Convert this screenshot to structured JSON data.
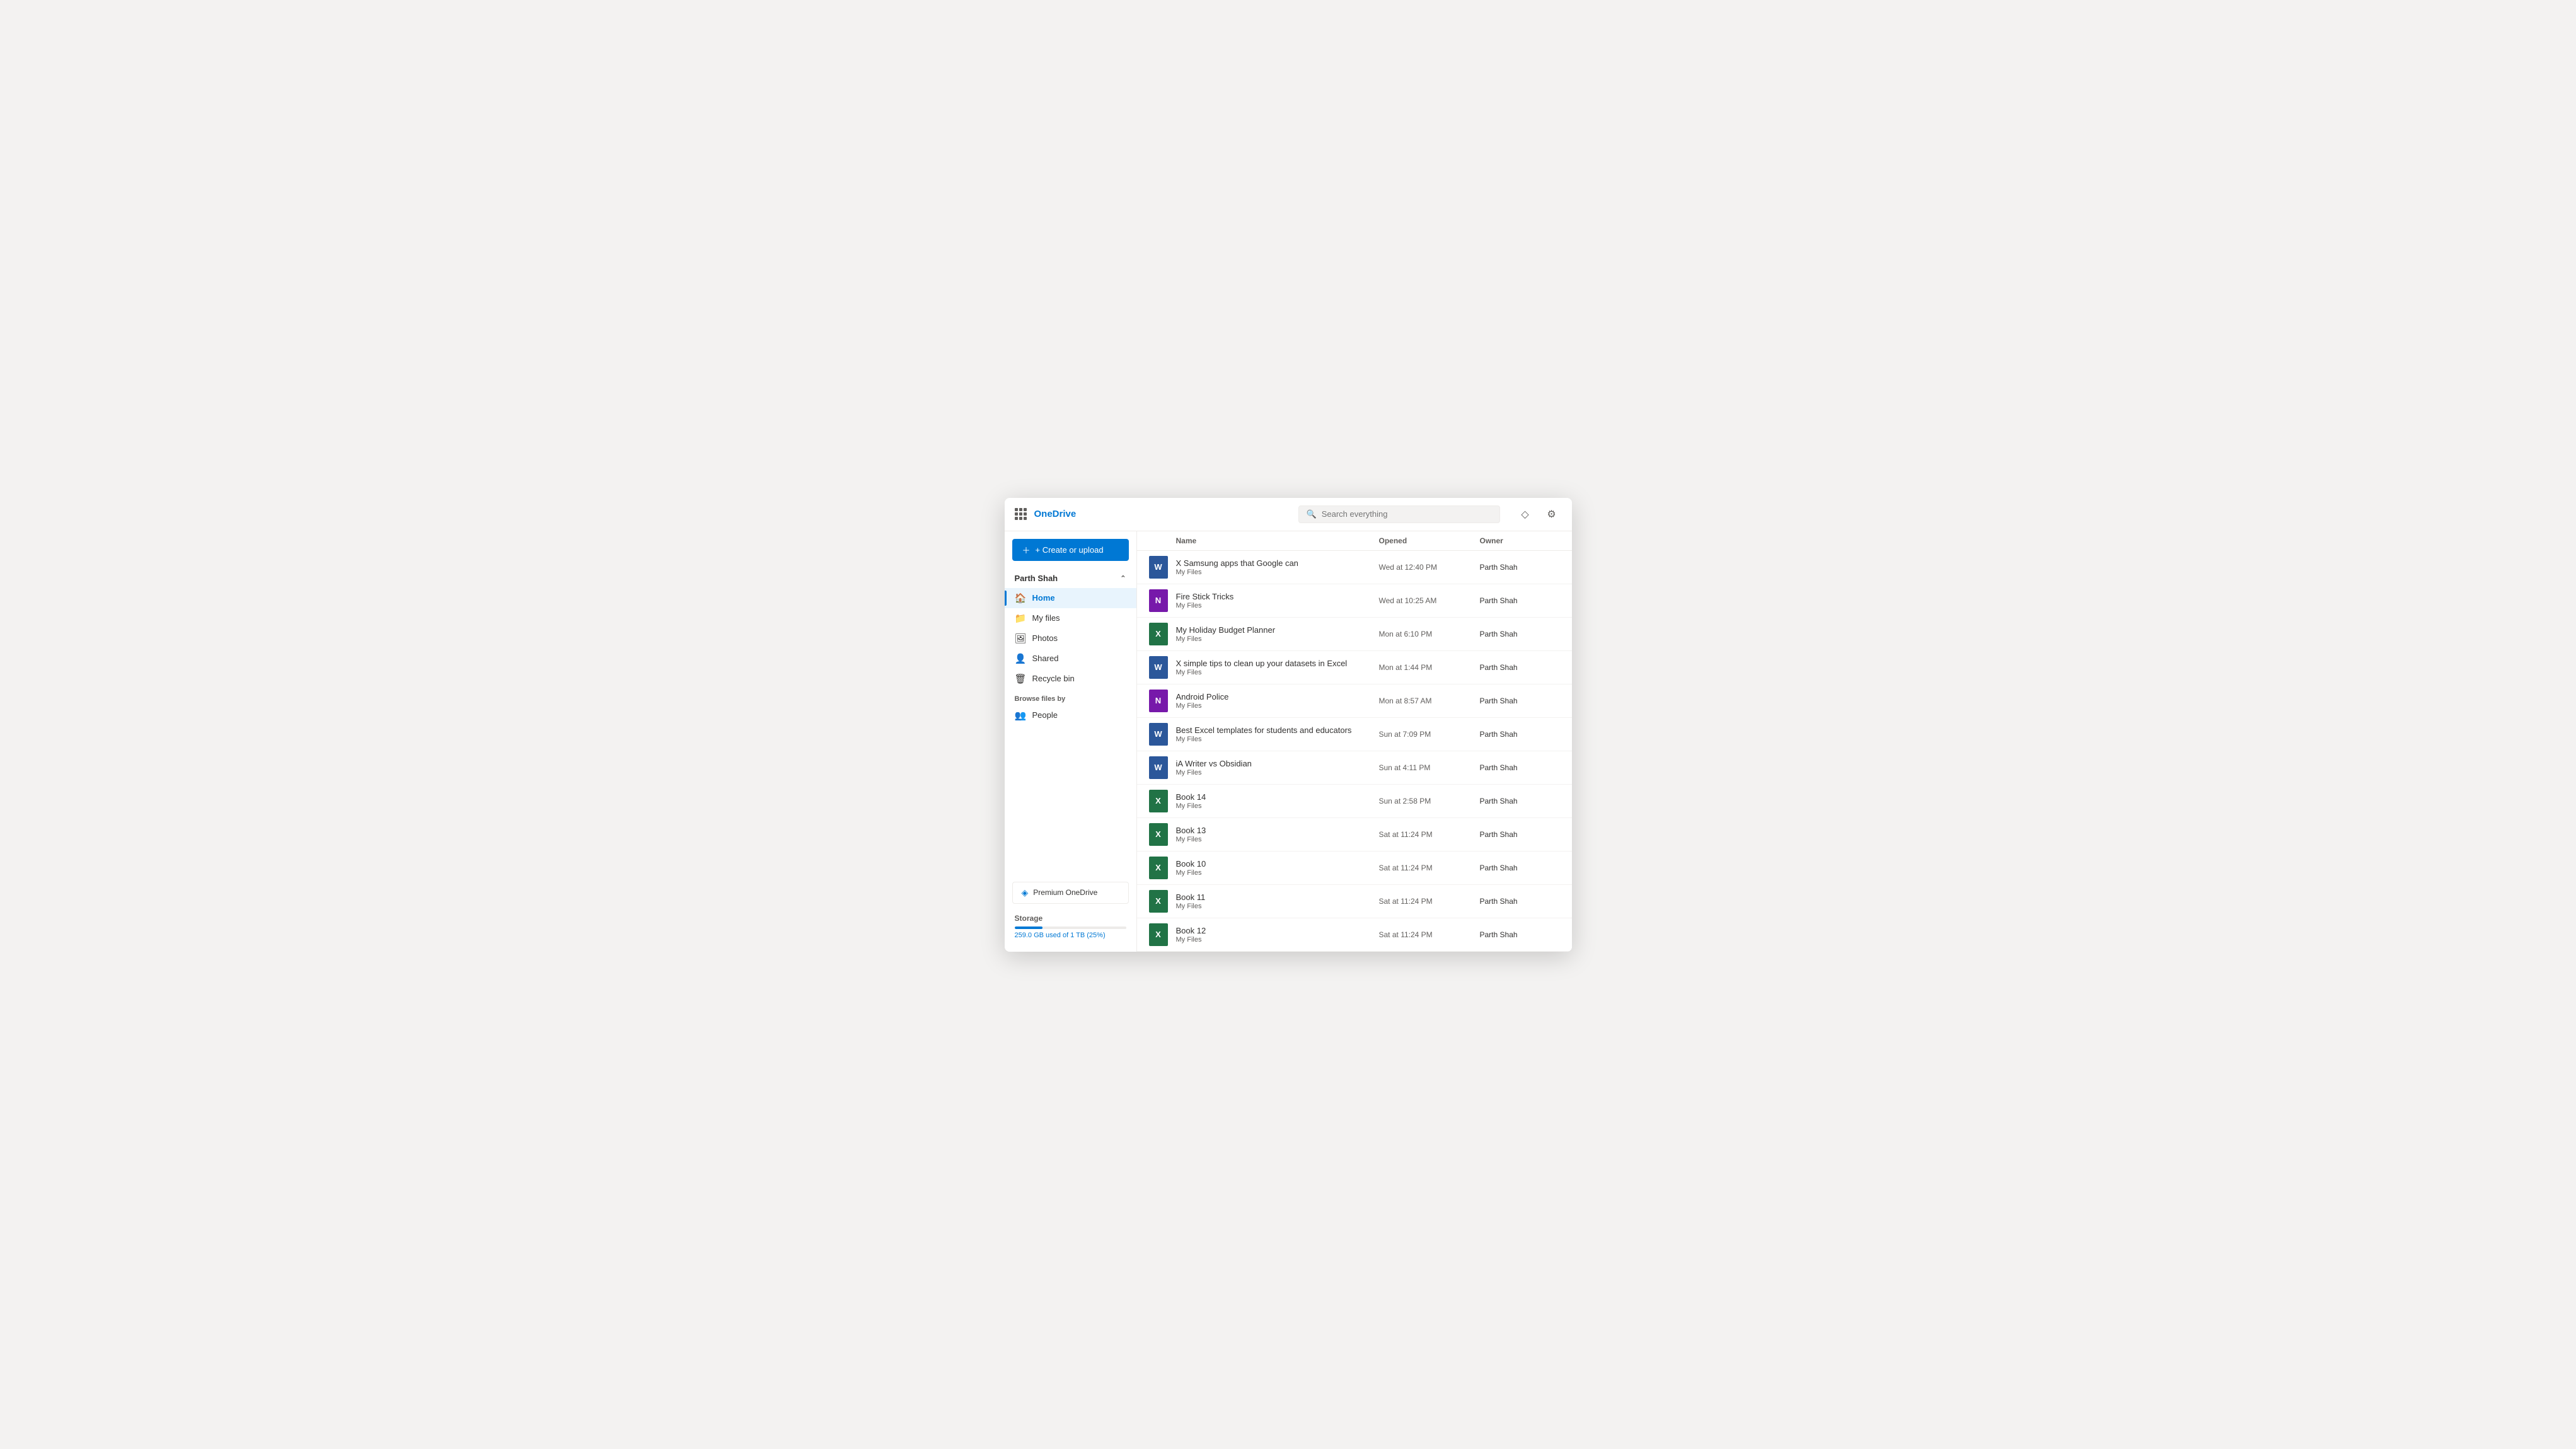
{
  "app": {
    "title": "OneDrive",
    "search_placeholder": "Search everything"
  },
  "top_icons": [
    {
      "name": "diamond-icon",
      "symbol": "◇"
    },
    {
      "name": "settings-icon",
      "symbol": "⚙"
    }
  ],
  "sidebar": {
    "create_label": "+ Create or upload",
    "user_name": "Parth Shah",
    "nav_items": [
      {
        "id": "home",
        "label": "Home",
        "icon": "🏠",
        "active": true
      },
      {
        "id": "my-files",
        "label": "My files",
        "icon": "📁",
        "active": false
      },
      {
        "id": "photos",
        "label": "Photos",
        "icon": "🖼",
        "active": false
      },
      {
        "id": "shared",
        "label": "Shared",
        "icon": "👤",
        "active": false
      },
      {
        "id": "recycle-bin",
        "label": "Recycle bin",
        "icon": "🗑",
        "active": false
      }
    ],
    "browse_label": "Browse files by",
    "browse_items": [
      {
        "id": "people",
        "label": "People",
        "icon": "👥"
      }
    ],
    "premium_label": "Premium OneDrive",
    "storage_label": "Storage",
    "storage_used": "259.0 GB",
    "storage_total": "used of 1 TB (25%)",
    "storage_percent": 25
  },
  "file_list": {
    "columns": {
      "name": "Name",
      "opened": "Opened",
      "owner": "Owner"
    },
    "files": [
      {
        "name": "X Samsung apps that Google can",
        "location": "My Files",
        "opened": "Wed at 12:40 PM",
        "owner": "Parth Shah",
        "type": "word"
      },
      {
        "name": "Fire Stick Tricks",
        "location": "My Files",
        "opened": "Wed at 10:25 AM",
        "owner": "Parth Shah",
        "type": "onenote"
      },
      {
        "name": "My Holiday Budget Planner",
        "location": "My Files",
        "opened": "Mon at 6:10 PM",
        "owner": "Parth Shah",
        "type": "excel"
      },
      {
        "name": "X simple tips to clean up your datasets in Excel",
        "location": "My Files",
        "opened": "Mon at 1:44 PM",
        "owner": "Parth Shah",
        "type": "word"
      },
      {
        "name": "Android Police",
        "location": "My Files",
        "opened": "Mon at 8:57 AM",
        "owner": "Parth Shah",
        "type": "onenote"
      },
      {
        "name": "Best Excel templates for students and educators",
        "location": "My Files",
        "opened": "Sun at 7:09 PM",
        "owner": "Parth Shah",
        "type": "word"
      },
      {
        "name": "iA Writer vs Obsidian",
        "location": "My Files",
        "opened": "Sun at 4:11 PM",
        "owner": "Parth Shah",
        "type": "word"
      },
      {
        "name": "Book 14",
        "location": "My Files",
        "opened": "Sun at 2:58 PM",
        "owner": "Parth Shah",
        "type": "excel"
      },
      {
        "name": "Book 13",
        "location": "My Files",
        "opened": "Sat at 11:24 PM",
        "owner": "Parth Shah",
        "type": "excel"
      },
      {
        "name": "Book 10",
        "location": "My Files",
        "opened": "Sat at 11:24 PM",
        "owner": "Parth Shah",
        "type": "excel"
      },
      {
        "name": "Book 11",
        "location": "My Files",
        "opened": "Sat at 11:24 PM",
        "owner": "Parth Shah",
        "type": "excel"
      },
      {
        "name": "Book 12",
        "location": "My Files",
        "opened": "Sat at 11:24 PM",
        "owner": "Parth Shah",
        "type": "excel"
      }
    ]
  }
}
